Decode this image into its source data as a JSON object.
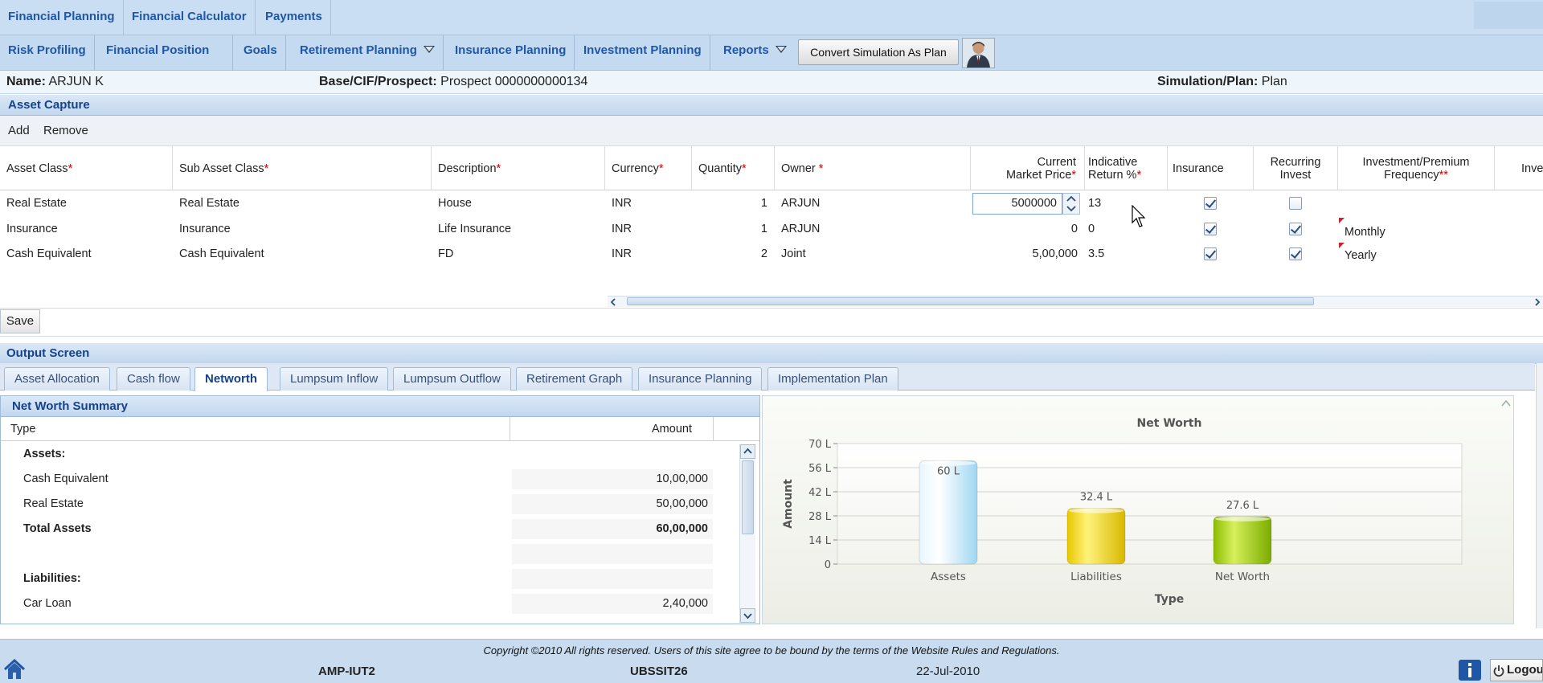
{
  "topnav": {
    "tabs": [
      "Financial Planning",
      "Financial Calculator",
      "Payments"
    ]
  },
  "subnav": {
    "tabs": [
      "Risk Profiling",
      "Financial Position",
      "Goals",
      "Retirement Planning",
      "Insurance Planning",
      "Investment Planning",
      "Reports"
    ],
    "convert_button": "Convert Simulation As Plan"
  },
  "info": {
    "name_label": "Name:",
    "name_value": "ARJUN K",
    "cif_label": "Base/CIF/Prospect:",
    "cif_value": "Prospect 0000000000134",
    "sim_label": "Simulation/Plan:",
    "sim_value": "Plan"
  },
  "asset_capture": {
    "title": "Asset Capture",
    "add_label": "Add",
    "remove_label": "Remove",
    "columns": {
      "asset_class": "Asset Class",
      "sub_asset_class": "Sub Asset Class",
      "description": "Description",
      "currency": "Currency",
      "quantity": "Quantity",
      "owner": "Owner ",
      "price_line1": "Current",
      "price_line2": "Market Price",
      "return_line1": "Indicative",
      "return_line2": "Return %",
      "insurance": "Insurance",
      "recurring_line1": "Recurring",
      "recurring_line2": "Invest",
      "freq_line1": "Investment/Premium",
      "freq_line2": "Frequency",
      "inve": "Inve",
      "req_mark": "*",
      "req_mark2": "**"
    },
    "rows": [
      {
        "asset_class": "Real Estate",
        "sub_asset_class": "Real Estate",
        "description": "House",
        "currency": "INR",
        "quantity": "1",
        "owner": "ARJUN",
        "price": "5000000",
        "return": "13",
        "insurance": true,
        "recurring": false,
        "frequency": ""
      },
      {
        "asset_class": "Insurance",
        "sub_asset_class": "Insurance",
        "description": "Life Insurance",
        "currency": "INR",
        "quantity": "1",
        "owner": "ARJUN",
        "price": "0",
        "return": "0",
        "insurance": true,
        "recurring": true,
        "frequency": "Monthly"
      },
      {
        "asset_class": "Cash Equivalent",
        "sub_asset_class": "Cash Equivalent",
        "description": "FD",
        "currency": "INR",
        "quantity": "2",
        "owner": "Joint",
        "price": "5,00,000",
        "return": "3.5",
        "insurance": true,
        "recurring": true,
        "frequency": "Yearly"
      }
    ],
    "save_label": "Save"
  },
  "output": {
    "title": "Output Screen",
    "tabs": [
      "Asset Allocation",
      "Cash flow",
      "Networth",
      "Lumpsum Inflow",
      "Lumpsum Outflow",
      "Retirement Graph",
      "Insurance Planning",
      "Implementation Plan"
    ],
    "active_tab": "Networth"
  },
  "networth": {
    "title": "Net Worth Summary",
    "col_type": "Type",
    "col_amount": "Amount",
    "assets_heading": "Assets:",
    "rows": [
      {
        "label": "Cash Equivalent",
        "value": "10,00,000"
      },
      {
        "label": "Real Estate",
        "value": "50,00,000"
      }
    ],
    "total_label": "Total Assets",
    "total_value": "60,00,000",
    "liab_heading": "Liabilities:",
    "liab_rows": [
      {
        "label": "Car Loan",
        "value": "2,40,000"
      }
    ]
  },
  "chart_data": {
    "type": "bar",
    "title": "Net Worth",
    "xlabel": "Type",
    "ylabel": "Amount",
    "categories": [
      "Assets",
      "Liabilities",
      "Net Worth"
    ],
    "values": [
      60,
      32.4,
      27.6
    ],
    "value_labels": [
      "60 L",
      "32.4 L",
      "27.6 L"
    ],
    "yticks": [
      "0",
      "14 L",
      "28 L",
      "42 L",
      "56 L",
      "70 L"
    ],
    "ytick_values": [
      0,
      14,
      28,
      42,
      56,
      70
    ],
    "ylim": [
      0,
      70
    ],
    "unit": "L",
    "colors": [
      "#bfe6f8",
      "#f2d800",
      "#a8d000"
    ],
    "grid": true
  },
  "footer": {
    "copyright": "Copyright ©2010 All rights reserved. Users of this site agree to be bound by the terms of the Website Rules and Regulations.",
    "server1": "AMP-IUT2",
    "server2": "UBSSIT26",
    "date": "22-Jul-2010",
    "logout": "Logou"
  },
  "colors": {
    "nav_text": "#1f56a6",
    "header_text": "#15428b",
    "required": "#cc0000"
  }
}
